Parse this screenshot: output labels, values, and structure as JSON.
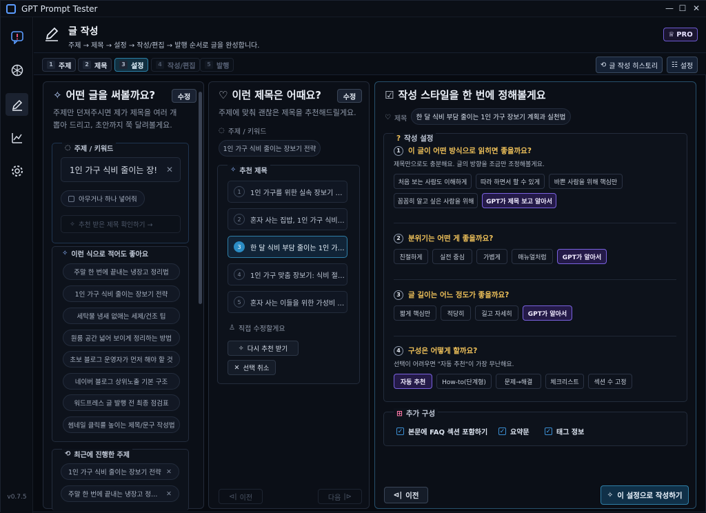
{
  "window": {
    "title": "GPT Prompt Tester"
  },
  "sidebar": {
    "version": "v0.7.5"
  },
  "header": {
    "title": "글 작성",
    "subtitle": "주제 → 제목 → 설정 → 작성/편집 → 발행 순서로 글을 완성합니다.",
    "pro_label": "PRO"
  },
  "steps": [
    {
      "num": "1",
      "label": "주제"
    },
    {
      "num": "2",
      "label": "제목"
    },
    {
      "num": "3",
      "label": "설정"
    },
    {
      "num": "4",
      "label": "작성/편집"
    },
    {
      "num": "5",
      "label": "발행"
    }
  ],
  "toolbar": {
    "history_label": "글 작성 히스토리",
    "settings_label": "설정"
  },
  "topic_panel": {
    "title": "어떤 글을 써볼까요?",
    "edit_label": "수정",
    "desc_line1": "주제만 던져주시면 제가 제목을 여러 개",
    "desc_line2": "뽑아 드리고, 초안까지 쭉 달려볼게요.",
    "keyword_label": "주제 / 키워드",
    "keyword_value": "1인 가구 식비 줄이는 장!",
    "anything_label": "아무거나 하나 넣어줘",
    "check_title_label": "추천 받은 제목 확인하기 →",
    "examples_label": "이런 식으로 적어도 좋아요",
    "examples": [
      "주말 한 번에 끝내는 냉장고 정리법",
      "1인 가구 식비 줄이는 장보기 전략",
      "세탁물 냄새 없애는 세제/건조 팁",
      "원룸 공간 넓어 보이게 정리하는 방법",
      "초보 블로그 운영자가 먼저 해야 할 것",
      "네이버 블로그 상위노출 기본 구조",
      "워드프레스 글 발행 전 최종 점검표",
      "썸네일 클릭률 높이는 제목/문구 작성법"
    ],
    "recent_label": "최근에 진행한 주제",
    "recent": [
      "1인 가구 식비 줄이는 장보기 전략",
      "주말 한 번에 끝내는 냉장고 정…"
    ]
  },
  "title_panel": {
    "title": "이런 제목은 어때요?",
    "edit_label": "수정",
    "desc": "주제에 맞춰 괜찮은 제목을 추천해드릴게요.",
    "keyword_label": "주제 / 키워드",
    "keyword_chip": "1인 가구 식비 줄이는 장보기 전략",
    "rec_label": "추천 제목",
    "titles": [
      "1인 가구를 위한 실속 장보기 …",
      "혼자 사는 집밥, 1인 가구 식비…",
      "한 달 식비 부담 줄이는 1인 가…",
      "1인 가구 맞춤 장보기: 식비 절…",
      "혼자 사는 이들을 위한 가성비 …"
    ],
    "titles_nums": [
      "1",
      "2",
      "3",
      "4",
      "5"
    ],
    "direct_edit_label": "직접 수정할게요",
    "retry_label": "다시 추천 받기",
    "cancel_label": "선택 취소",
    "prev_label": "이전",
    "next_label": "다음"
  },
  "style_panel": {
    "title": "작성 스타일을 한 번에 정해볼게요",
    "subject_label": "제목",
    "subject_value": "한 달 식비 부담 줄이는 1인 가구 장보기 계획과 실천법",
    "settings_label": "작성 설정",
    "q1": {
      "num": "1",
      "label": "이 글이 어떤 방식으로 읽히면 좋을까요?",
      "desc": "제목만으로도 충분해요. 글의 방향을 조금만 조정해볼게요.",
      "options": [
        "처음 보는 사람도 이해하게",
        "따라 하면서 할 수 있게",
        "바쁜 사람을 위해 핵심만",
        "꼼꼼히 알고 싶은 사람을 위해",
        "GPT가 제목 보고 알아서"
      ]
    },
    "q2": {
      "num": "2",
      "label": "분위기는 어떤 게 좋을까요?",
      "options": [
        "친절하게",
        "실전 중심",
        "가볍게",
        "매뉴얼처럼",
        "GPT가 알아서"
      ]
    },
    "q3": {
      "num": "3",
      "label": "글 길이는 어느 정도가 좋을까요?",
      "options": [
        "짧게 핵심만",
        "적당히",
        "길고 자세히",
        "GPT가 알아서"
      ]
    },
    "q4": {
      "num": "4",
      "label": "구성은 어떻게 할까요?",
      "desc": "선택이 어려우면 \"자동 추천\"이 가장 무난해요.",
      "options": [
        "자동 추천",
        "How-to(단계형)",
        "문제→해결",
        "체크리스트",
        "섹션 수 고정"
      ]
    },
    "extra_label": "추가 구성",
    "extras": [
      "본문에 FAQ 섹션 포함하기",
      "요약문",
      "태그 정보"
    ],
    "prev_label": "이전",
    "write_label": "이 설정으로 작성하기"
  },
  "colors": {
    "accent": "#2b8cc4",
    "selected": "#7a62e0",
    "question": "#f0c25a"
  }
}
